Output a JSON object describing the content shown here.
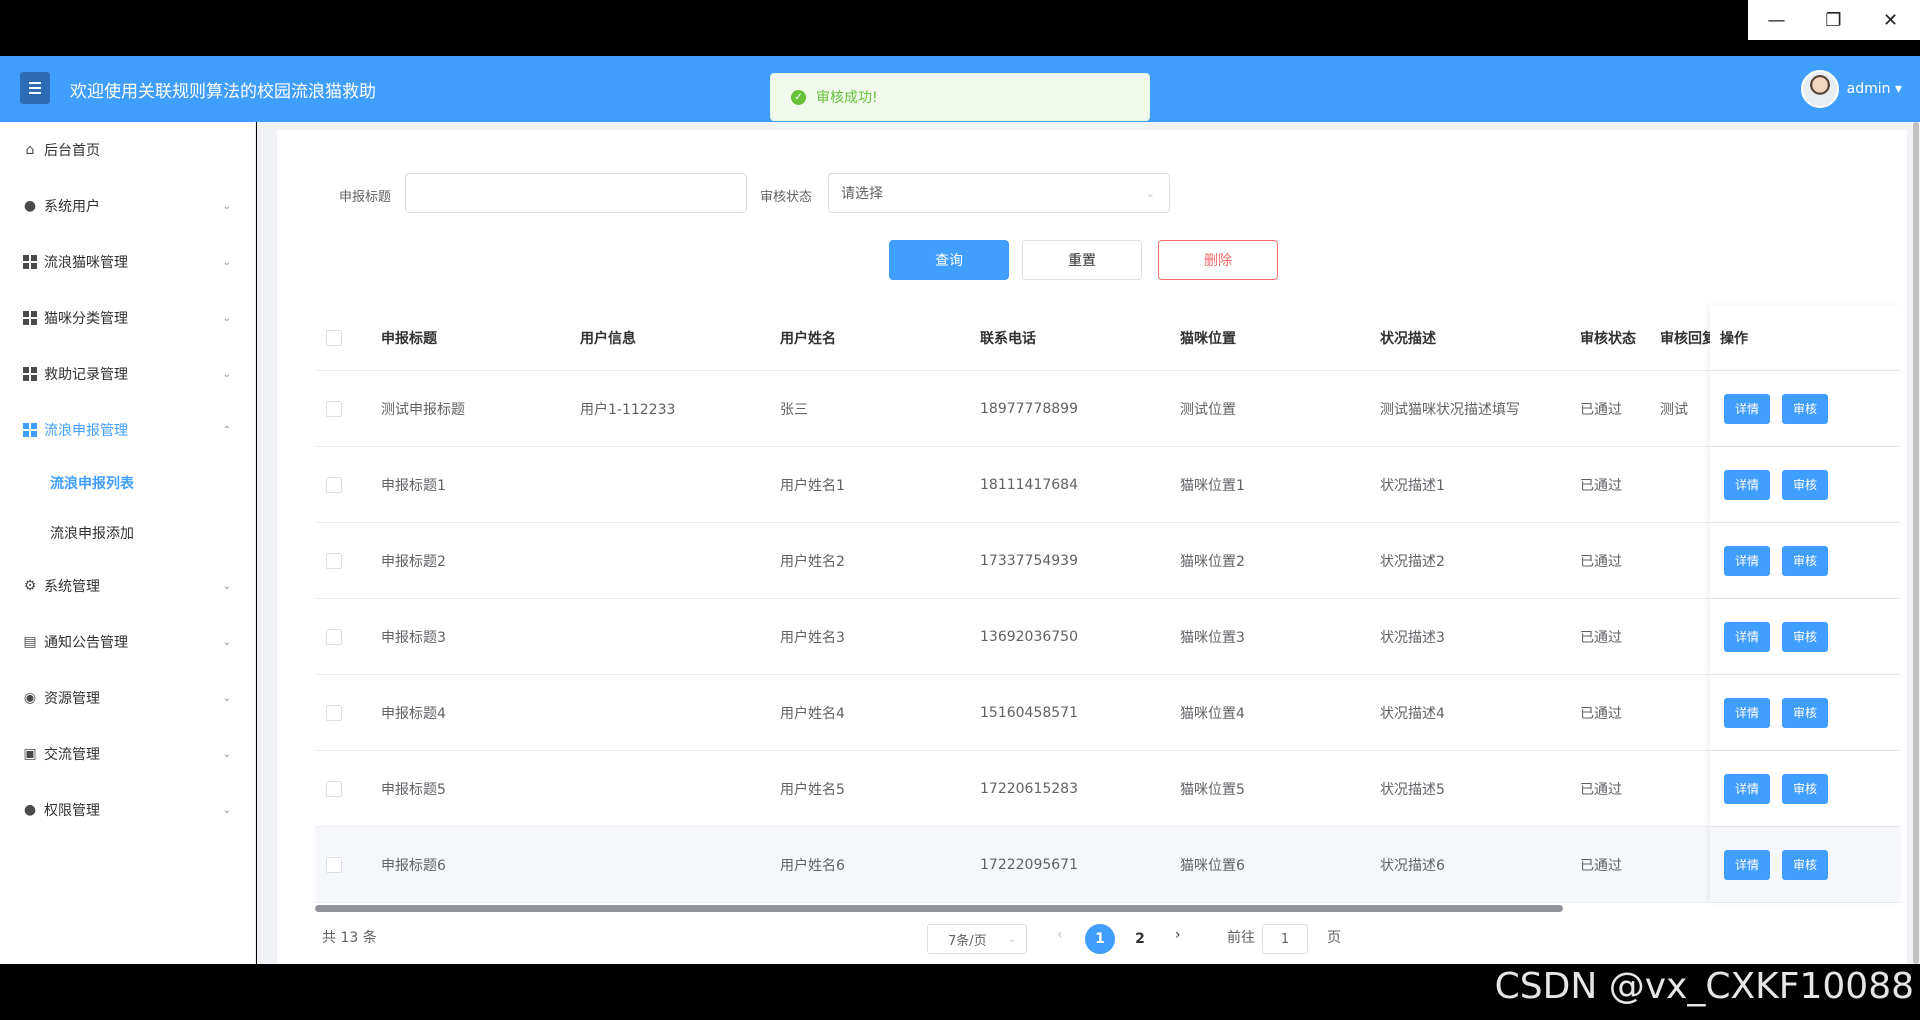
{
  "window": {
    "minimize": "—",
    "maximize": "❐",
    "close": "✕"
  },
  "header": {
    "title": "欢迎使用关联规则算法的校园流浪猫救助",
    "user": "admin ▾"
  },
  "toast": {
    "text": "审核成功!"
  },
  "sidebar": {
    "items": [
      {
        "label": "后台首页"
      },
      {
        "label": "系统用户"
      },
      {
        "label": "流浪猫咪管理"
      },
      {
        "label": "猫咪分类管理"
      },
      {
        "label": "救助记录管理"
      },
      {
        "label": "流浪申报管理"
      },
      {
        "label": "系统管理"
      },
      {
        "label": "通知公告管理"
      },
      {
        "label": "资源管理"
      },
      {
        "label": "交流管理"
      },
      {
        "label": "权限管理"
      }
    ],
    "sub_items": [
      {
        "label": "流浪申报列表"
      },
      {
        "label": "流浪申报添加"
      }
    ]
  },
  "filters": {
    "title_label": "申报标题",
    "title_value": "",
    "status_label": "审核状态",
    "status_placeholder": "请选择"
  },
  "actions": {
    "query": "查询",
    "reset": "重置",
    "delete": "删除"
  },
  "table": {
    "columns": [
      "申报标题",
      "用户信息",
      "用户姓名",
      "联系电话",
      "猫咪位置",
      "状况描述",
      "审核状态",
      "审核回复",
      "操作"
    ],
    "rows": [
      {
        "title": "测试申报标题",
        "user_info": "用户1-112233",
        "name": "张三",
        "phone": "18977778899",
        "location": "测试位置",
        "desc": "测试猫咪状况描述填写",
        "status": "已通过",
        "reply": "测试"
      },
      {
        "title": "申报标题1",
        "user_info": "",
        "name": "用户姓名1",
        "phone": "18111417684",
        "location": "猫咪位置1",
        "desc": "状况描述1",
        "status": "已通过",
        "reply": ""
      },
      {
        "title": "申报标题2",
        "user_info": "",
        "name": "用户姓名2",
        "phone": "17337754939",
        "location": "猫咪位置2",
        "desc": "状况描述2",
        "status": "已通过",
        "reply": ""
      },
      {
        "title": "申报标题3",
        "user_info": "",
        "name": "用户姓名3",
        "phone": "13692036750",
        "location": "猫咪位置3",
        "desc": "状况描述3",
        "status": "已通过",
        "reply": ""
      },
      {
        "title": "申报标题4",
        "user_info": "",
        "name": "用户姓名4",
        "phone": "15160458571",
        "location": "猫咪位置4",
        "desc": "状况描述4",
        "status": "已通过",
        "reply": ""
      },
      {
        "title": "申报标题5",
        "user_info": "",
        "name": "用户姓名5",
        "phone": "17220615283",
        "location": "猫咪位置5",
        "desc": "状况描述5",
        "status": "已通过",
        "reply": ""
      },
      {
        "title": "申报标题6",
        "user_info": "",
        "name": "用户姓名6",
        "phone": "17222095671",
        "location": "猫咪位置6",
        "desc": "状况描述6",
        "status": "已通过",
        "reply": ""
      }
    ],
    "row_actions": {
      "detail": "详情",
      "audit": "审核"
    }
  },
  "pagination": {
    "total": "共 13 条",
    "page_size": "7条/页",
    "prev": "‹",
    "next": "›",
    "pages": [
      "1",
      "2"
    ],
    "goto_label": "前往",
    "goto_value": "1",
    "page_suffix": "页"
  },
  "watermark": "CSDN @vx_CXKF10088",
  "colors": {
    "primary": "#409eff",
    "danger": "#f56c6c",
    "success": "#67c23a"
  }
}
